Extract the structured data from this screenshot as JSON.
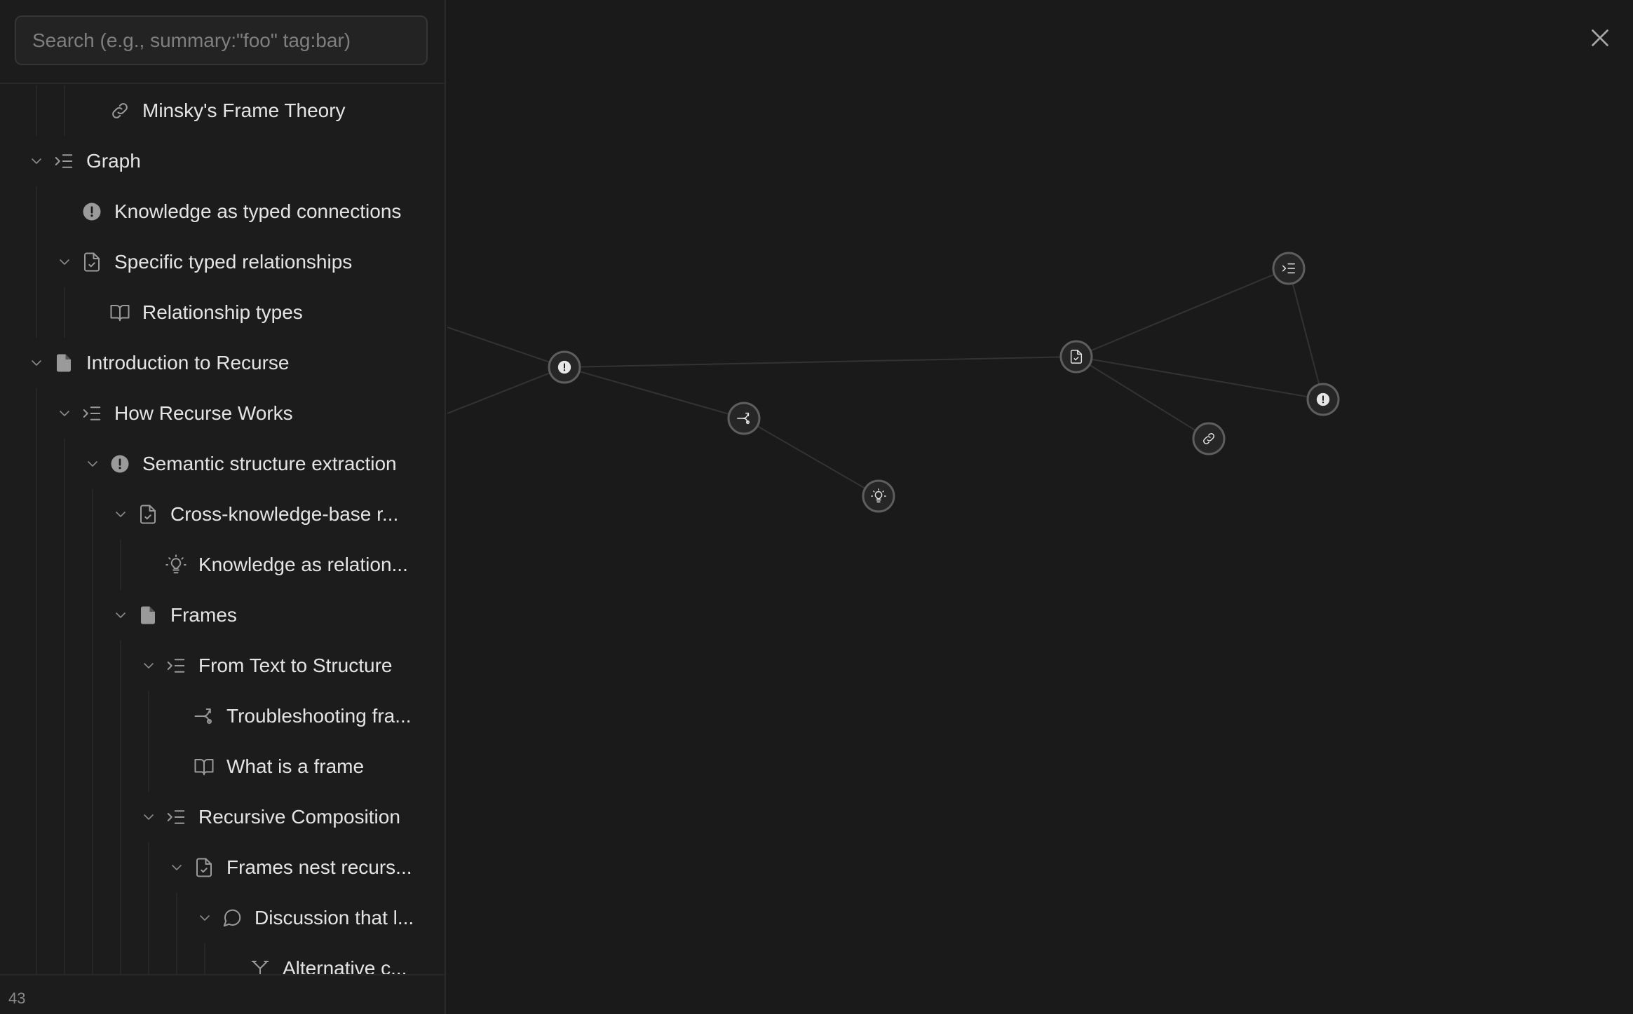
{
  "search": {
    "placeholder": "Search (e.g., summary:\"foo\" tag:bar)",
    "value": ""
  },
  "tree": {
    "items": [
      {
        "label": "Minsky's Frame Theory",
        "icon": "link-icon",
        "depth": 3,
        "expandable": false
      },
      {
        "label": "Graph",
        "icon": "list-indent-icon",
        "depth": 1,
        "expandable": true
      },
      {
        "label": "Knowledge as typed connections",
        "icon": "alert-circle-icon",
        "depth": 2,
        "expandable": false
      },
      {
        "label": "Specific typed relationships",
        "icon": "file-check-icon",
        "depth": 2,
        "expandable": true
      },
      {
        "label": "Relationship types",
        "icon": "book-open-icon",
        "depth": 3,
        "expandable": false
      },
      {
        "label": "Introduction to Recurse",
        "icon": "file-filled-icon",
        "depth": 1,
        "expandable": true
      },
      {
        "label": "How Recurse Works",
        "icon": "list-indent-icon",
        "depth": 2,
        "expandable": true
      },
      {
        "label": "Semantic structure extraction",
        "icon": "alert-circle-icon",
        "depth": 3,
        "expandable": true
      },
      {
        "label": "Cross-knowledge-base r...",
        "icon": "file-check-icon",
        "depth": 4,
        "expandable": true
      },
      {
        "label": "Knowledge as relation...",
        "icon": "lightbulb-icon",
        "depth": 5,
        "expandable": false
      },
      {
        "label": "Frames",
        "icon": "file-filled-icon",
        "depth": 4,
        "expandable": true
      },
      {
        "label": "From Text to Structure",
        "icon": "list-indent-icon",
        "depth": 5,
        "expandable": true
      },
      {
        "label": "Troubleshooting fra...",
        "icon": "git-merge-icon",
        "depth": 6,
        "expandable": false
      },
      {
        "label": "What is a frame",
        "icon": "book-open-icon",
        "depth": 6,
        "expandable": false
      },
      {
        "label": "Recursive Composition",
        "icon": "list-indent-icon",
        "depth": 5,
        "expandable": true
      },
      {
        "label": "Frames nest recurs...",
        "icon": "file-check-icon",
        "depth": 6,
        "expandable": true
      },
      {
        "label": "Discussion that l...",
        "icon": "message-circle-icon",
        "depth": 7,
        "expandable": true
      },
      {
        "label": "Alternative c...",
        "icon": "git-fork-icon",
        "depth": 8,
        "expandable": false
      }
    ]
  },
  "footer": {
    "count": "43"
  },
  "graph": {
    "nodes": [
      {
        "name": "alert-circle-icon",
        "kind": "alert"
      },
      {
        "name": "git-merge-icon",
        "kind": "merge"
      },
      {
        "name": "lightbulb-icon",
        "kind": "bulb"
      },
      {
        "name": "file-check-icon",
        "kind": "filecheck"
      },
      {
        "name": "list-indent-icon",
        "kind": "listindent"
      },
      {
        "name": "alert-circle-icon",
        "kind": "alert"
      },
      {
        "name": "link-icon",
        "kind": "link"
      }
    ]
  },
  "colors": {
    "background": "#1a1a1a",
    "sidebar": "#1c1c1c",
    "text": "#e4e4e4",
    "icon": "#9a9a9a",
    "node_ring": "#5e5e5e",
    "edge": "#333333"
  },
  "close_icon": "close-icon"
}
